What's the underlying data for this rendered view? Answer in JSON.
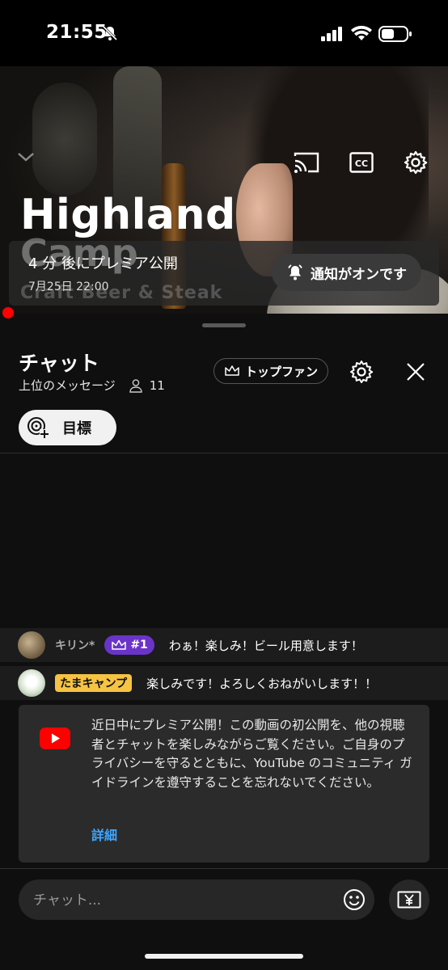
{
  "status_bar": {
    "time": "21:55"
  },
  "video": {
    "title_overlay": "Highland",
    "ghost_title": "Camp",
    "ghost_subtitle": "Craft Beer & Steak",
    "premiere_countdown": "4 分 後にプレミア公開",
    "premiere_datetime": "7月25日 22:00",
    "notify_label": "通知がオンです"
  },
  "chat_panel": {
    "title": "チャット",
    "mode_label": "上位のメッセージ",
    "viewer_count": "11",
    "top_fan_label": "トップファン",
    "goal_label": "目標"
  },
  "messages": [
    {
      "author": "キリン*",
      "badge": "#1",
      "text": "わぁ！楽しみ！ビール用意します！"
    },
    {
      "author": "たまキャンプ",
      "text": "楽しみです！よろしくおねがいします！！"
    }
  ],
  "notice": {
    "text": "近日中にプレミア公開！この動画の初公開を、他の視聴者とチャットを楽しみながらご覧ください。ご自身のプライバシーを守るとともに、YouTube のコミュニティ ガイドラインを遵守することを忘れないでください。",
    "link_label": "詳細"
  },
  "input": {
    "placeholder": "チャット..."
  },
  "colors": {
    "accent_red": "#ff0000",
    "rank_purple": "#6a34c8",
    "member_yellow": "#f6c343",
    "link_blue": "#3ea6ff"
  }
}
